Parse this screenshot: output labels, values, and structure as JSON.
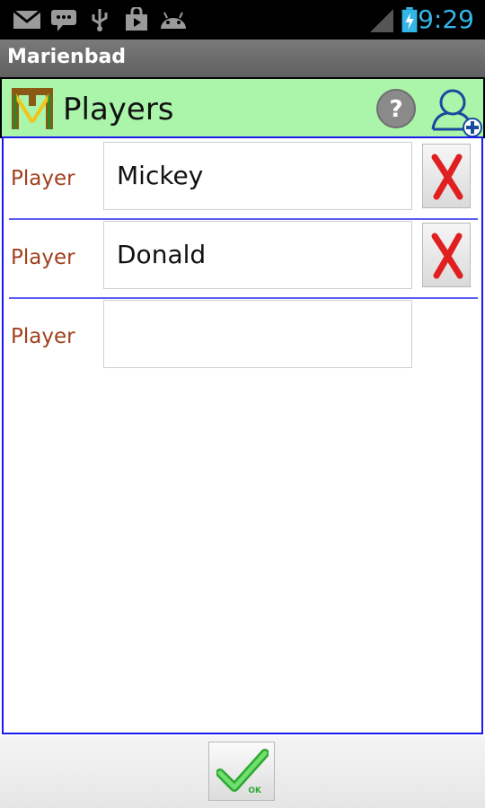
{
  "status_bar": {
    "time": "9:29",
    "icons": [
      "gmail-icon",
      "sms-icon",
      "usb-icon",
      "store-icon",
      "android-icon",
      "signal-icon",
      "battery-icon"
    ],
    "accent_color": "#33b5e5"
  },
  "app": {
    "title": "Marienbad"
  },
  "header": {
    "title": "Players",
    "background_color": "#aaf5aa",
    "icons": [
      "logo-icon",
      "help-icon",
      "add-user-icon"
    ]
  },
  "players": [
    {
      "label": "Player",
      "value": "Mickey",
      "removable": true
    },
    {
      "label": "Player",
      "value": "Donald",
      "removable": true
    },
    {
      "label": "Player",
      "value": "",
      "removable": false
    }
  ],
  "footer": {
    "ok_label": "OK"
  },
  "colors": {
    "label": "#a0411e",
    "border": "#1a1aee",
    "remove_x": "#e02020",
    "ok_check": "#3cc83c"
  }
}
